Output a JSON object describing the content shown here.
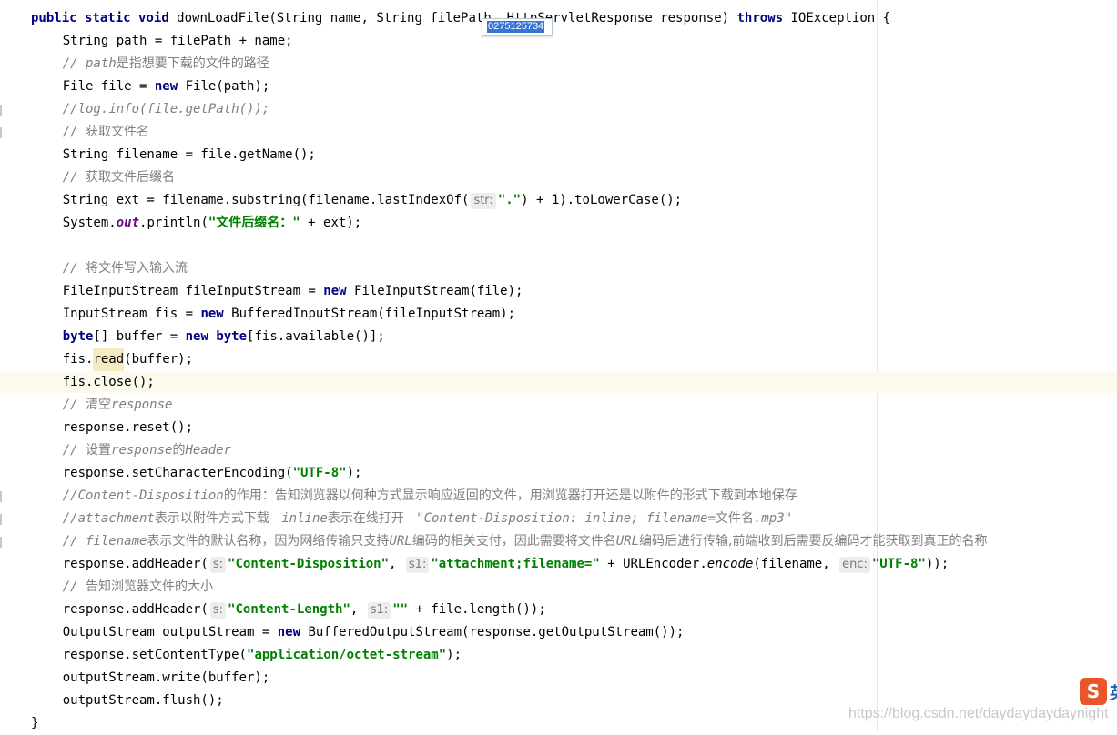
{
  "tooltip": {
    "text": "0275125734"
  },
  "watermark": "https://blog.csdn.net/daydaydaydaynight",
  "ime_badge": {
    "logo": "S",
    "tail": "英",
    "brand_color": "#e8562a"
  },
  "colors": {
    "keyword": "#000080",
    "string": "#008000",
    "comment": "#808080",
    "static_field": "#660e7a",
    "caret_line": "#fcfaed",
    "usage_highlight": "#f5eac1"
  },
  "lines": [
    [
      [
        "kw",
        "public"
      ],
      [
        "t",
        " "
      ],
      [
        "kw",
        "static"
      ],
      [
        "t",
        " "
      ],
      [
        "kw",
        "void"
      ],
      [
        "t",
        " downLoadFile(String name, String filePath, HttpServletResponse response) "
      ],
      [
        "kw",
        "throws"
      ],
      [
        "t",
        " IOException {"
      ]
    ],
    [
      [
        "t",
        "    String path = filePath + name;"
      ]
    ],
    [
      [
        "t",
        "    "
      ],
      [
        "cm",
        "// path"
      ],
      [
        "cmc",
        "是指想要下载的文件的路径"
      ]
    ],
    [
      [
        "t",
        "    File file = "
      ],
      [
        "kw",
        "new"
      ],
      [
        "t",
        " File(path);"
      ]
    ],
    [
      [
        "t",
        "    "
      ],
      [
        "cm",
        "//log.info(file.getPath());"
      ]
    ],
    [
      [
        "t",
        "    "
      ],
      [
        "cm",
        "// "
      ],
      [
        "cmc",
        "获取文件名"
      ]
    ],
    [
      [
        "t",
        "    String filename = file.getName();"
      ]
    ],
    [
      [
        "t",
        "    "
      ],
      [
        "cm",
        "// "
      ],
      [
        "cmc",
        "获取文件后缀名"
      ]
    ],
    [
      [
        "t",
        "    String ext = filename.substring(filename.lastIndexOf("
      ],
      [
        "hint",
        "str:"
      ],
      [
        "str",
        "\".\""
      ],
      [
        "t",
        ") + 1).toLowerCase();"
      ]
    ],
    [
      [
        "t",
        "    System."
      ],
      [
        "fld",
        "out"
      ],
      [
        "t",
        ".println("
      ],
      [
        "str",
        "\"文件后缀名：\""
      ],
      [
        "t",
        " + ext);"
      ]
    ],
    [],
    [
      [
        "t",
        "    "
      ],
      [
        "cm",
        "// "
      ],
      [
        "cmc",
        "将文件写入输入流"
      ]
    ],
    [
      [
        "t",
        "    FileInputStream fileInputStream = "
      ],
      [
        "kw",
        "new"
      ],
      [
        "t",
        " FileInputStream(file);"
      ]
    ],
    [
      [
        "t",
        "    InputStream fis = "
      ],
      [
        "kw",
        "new"
      ],
      [
        "t",
        " BufferedInputStream(fileInputStream);"
      ]
    ],
    [
      [
        "t",
        "    "
      ],
      [
        "kw",
        "byte"
      ],
      [
        "t",
        "[] buffer = "
      ],
      [
        "kw",
        "new"
      ],
      [
        "t",
        " "
      ],
      [
        "kw",
        "byte"
      ],
      [
        "t",
        "[fis.available()];"
      ]
    ],
    [
      [
        "t",
        "    fis."
      ],
      [
        "use",
        "read"
      ],
      [
        "t",
        "(buffer);"
      ]
    ],
    [
      [
        "t",
        "    fis.close();"
      ]
    ],
    [
      [
        "t",
        "    "
      ],
      [
        "cm",
        "// "
      ],
      [
        "cmc",
        "清空"
      ],
      [
        "cm",
        "response"
      ]
    ],
    [
      [
        "t",
        "    response.reset();"
      ]
    ],
    [
      [
        "t",
        "    "
      ],
      [
        "cm",
        "// "
      ],
      [
        "cmc",
        "设置"
      ],
      [
        "cm",
        "response"
      ],
      [
        "cmc",
        "的"
      ],
      [
        "cm",
        "Header"
      ]
    ],
    [
      [
        "t",
        "    response.setCharacterEncoding("
      ],
      [
        "str",
        "\"UTF-8\""
      ],
      [
        "t",
        ");"
      ]
    ],
    [
      [
        "t",
        "    "
      ],
      [
        "cm",
        "//Content-Disposition"
      ],
      [
        "cmc",
        "的作用：告知浏览器以何种方式显示响应返回的文件，用浏览器打开还是以附件的形式下载到本地保存"
      ]
    ],
    [
      [
        "t",
        "    "
      ],
      [
        "cm",
        "//attachment"
      ],
      [
        "cmc",
        "表示以附件方式下载   "
      ],
      [
        "cm",
        "inline"
      ],
      [
        "cmc",
        "表示在线打开   "
      ],
      [
        "cm",
        "\"Content-Disposition: inline; filename="
      ],
      [
        "cmc",
        "文件名"
      ],
      [
        "cm",
        ".mp3\""
      ]
    ],
    [
      [
        "t",
        "    "
      ],
      [
        "cm",
        "// filename"
      ],
      [
        "cmc",
        "表示文件的默认名称，因为网络传输只支持"
      ],
      [
        "cm",
        "URL"
      ],
      [
        "cmc",
        "编码的相关支付，因此需要将文件名"
      ],
      [
        "cm",
        "URL"
      ],
      [
        "cmc",
        "编码后进行传输,前端收到后需要反编码才能获取到真正的名称"
      ]
    ],
    [
      [
        "t",
        "    response.addHeader("
      ],
      [
        "hint",
        "s:"
      ],
      [
        "str",
        "\"Content-Disposition\""
      ],
      [
        "t",
        ", "
      ],
      [
        "hint",
        "s1:"
      ],
      [
        "str",
        "\"attachment;filename=\""
      ],
      [
        "t",
        " + URLEncoder."
      ],
      [
        "st",
        "encode"
      ],
      [
        "t",
        "(filename, "
      ],
      [
        "hint",
        "enc:"
      ],
      [
        "str",
        "\"UTF-8\""
      ],
      [
        "t",
        "));"
      ]
    ],
    [
      [
        "t",
        "    "
      ],
      [
        "cm",
        "// "
      ],
      [
        "cmc",
        "告知浏览器文件的大小"
      ]
    ],
    [
      [
        "t",
        "    response.addHeader("
      ],
      [
        "hint",
        "s:"
      ],
      [
        "str",
        "\"Content-Length\""
      ],
      [
        "t",
        ", "
      ],
      [
        "hint",
        "s1:"
      ],
      [
        "str",
        "\"\""
      ],
      [
        "t",
        " + file.length());"
      ]
    ],
    [
      [
        "t",
        "    OutputStream outputStream = "
      ],
      [
        "kw",
        "new"
      ],
      [
        "t",
        " BufferedOutputStream(response.getOutputStream());"
      ]
    ],
    [
      [
        "t",
        "    response.setContentType("
      ],
      [
        "str",
        "\"application/octet-stream\""
      ],
      [
        "t",
        ");"
      ]
    ],
    [
      [
        "t",
        "    outputStream.write(buffer);"
      ]
    ],
    [
      [
        "t",
        "    outputStream.flush();"
      ]
    ],
    [
      [
        "t",
        "}"
      ]
    ]
  ]
}
